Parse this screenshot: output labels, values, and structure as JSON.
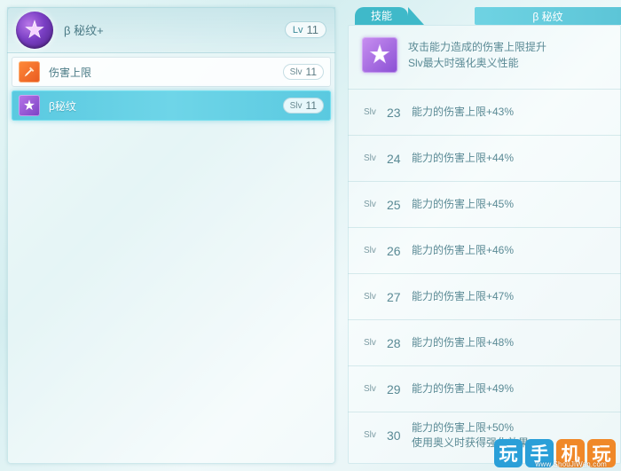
{
  "left": {
    "title": "β 秘纹+",
    "lv_label": "Lv",
    "lv_value": "11",
    "skills": [
      {
        "name": "伤害上限",
        "slv_label": "Slv",
        "slv_value": "11"
      },
      {
        "name": "β秘纹",
        "slv_label": "Slv",
        "slv_value": "11"
      }
    ]
  },
  "right": {
    "tab": "技能",
    "title": "β 秘纹",
    "desc_line1": "攻击能力造成的伤害上限提升",
    "desc_line2": "Slv最大时强化奥义性能",
    "levels": [
      {
        "slv": "Slv",
        "num": "23",
        "effect": "能力的伤害上限+43%"
      },
      {
        "slv": "Slv",
        "num": "24",
        "effect": "能力的伤害上限+44%"
      },
      {
        "slv": "Slv",
        "num": "25",
        "effect": "能力的伤害上限+45%"
      },
      {
        "slv": "Slv",
        "num": "26",
        "effect": "能力的伤害上限+46%"
      },
      {
        "slv": "Slv",
        "num": "27",
        "effect": "能力的伤害上限+47%"
      },
      {
        "slv": "Slv",
        "num": "28",
        "effect": "能力的伤害上限+48%"
      },
      {
        "slv": "Slv",
        "num": "29",
        "effect": "能力的伤害上限+49%"
      },
      {
        "slv": "Slv",
        "num": "30",
        "effect1": "能力的伤害上限+50%",
        "effect2": "使用奥义时获得强化效果"
      }
    ]
  },
  "watermark": {
    "chars": [
      "玩",
      "手",
      "机",
      "玩"
    ],
    "url": "www.ShouJiWan.com"
  }
}
